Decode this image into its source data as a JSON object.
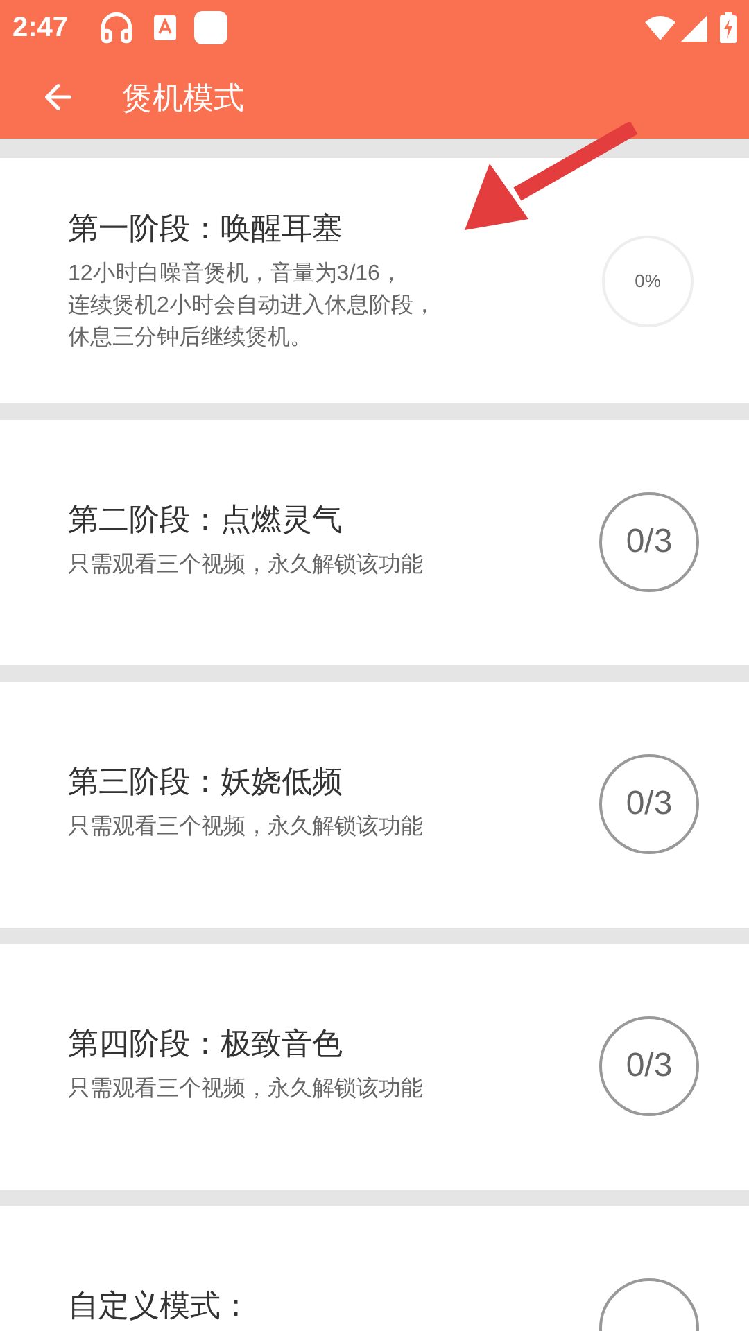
{
  "status_bar": {
    "time": "2:47"
  },
  "toolbar": {
    "title": "煲机模式"
  },
  "stages": [
    {
      "kind": "progress",
      "title": "第一阶段：唤醒耳塞",
      "description": [
        "12小时白噪音煲机，音量为3/16，",
        "连续煲机2小时会自动进入休息阶段，",
        "休息三分钟后继续煲机。"
      ],
      "reading": "0%"
    },
    {
      "kind": "counter",
      "title": "第二阶段：点燃灵气",
      "description": [
        "只需观看三个视频，永久解锁该功能"
      ],
      "reading": "0/3"
    },
    {
      "kind": "counter",
      "title": "第三阶段：妖娆低频",
      "description": [
        "只需观看三个视频，永久解锁该功能"
      ],
      "reading": "0/3"
    },
    {
      "kind": "counter",
      "title": "第四阶段：极致音色",
      "description": [
        "只需观看三个视频，永久解锁该功能"
      ],
      "reading": "0/3"
    },
    {
      "kind": "counter",
      "title": "自定义模式："
    }
  ]
}
